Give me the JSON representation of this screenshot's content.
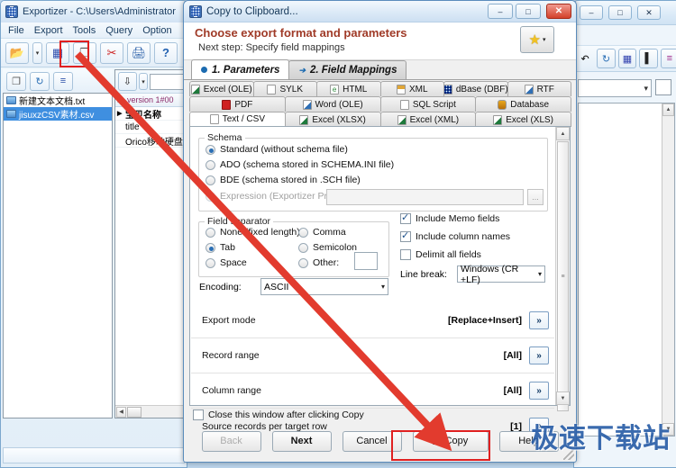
{
  "main_window": {
    "title": "Exportizer - C:\\Users\\Administrator",
    "icon": "grid-app-icon",
    "menu": [
      {
        "label": "File"
      },
      {
        "label": "Export"
      },
      {
        "label": "Tools"
      },
      {
        "label": "Query"
      },
      {
        "label": "Option"
      }
    ],
    "toolbar": [
      {
        "name": "open-button",
        "glyph": "📂"
      },
      {
        "name": "open-dropdown",
        "glyph": "▾"
      },
      {
        "name": "export-grid-button",
        "glyph": "▦"
      },
      {
        "name": "copy-to-clipboard-button",
        "glyph": "❐"
      },
      {
        "name": "script-button",
        "glyph": "✂"
      },
      {
        "name": "print-button",
        "glyph": "🖨"
      },
      {
        "name": "help-button",
        "glyph": "?"
      }
    ],
    "sub_toolbar": [
      {
        "name": "duplicate-button",
        "glyph": "❐"
      },
      {
        "name": "refresh-button",
        "glyph": "↻"
      },
      {
        "name": "list-button",
        "glyph": "≡"
      }
    ],
    "file_list": [
      {
        "label": "新建文本文档.txt",
        "selected": false
      },
      {
        "label": "jisuxzCSV素材.csv",
        "selected": true
      }
    ],
    "grid": {
      "header": "version 1#00",
      "rows": [
        {
          "mark": "▶",
          "value": "宝贝名称"
        },
        {
          "mark": "",
          "value": "title"
        },
        {
          "mark": "",
          "value": "Orico移动硬盘"
        }
      ]
    }
  },
  "background_window": {
    "title_buttons": [
      {
        "name": "minimize-button",
        "glyph": "–"
      },
      {
        "name": "maximize-button",
        "glyph": "□"
      },
      {
        "name": "close-button",
        "glyph": "✕"
      }
    ],
    "toolbar": [
      {
        "name": "undo-icon",
        "glyph": "↶"
      },
      {
        "name": "refresh-icon",
        "glyph": "↻"
      },
      {
        "name": "grid-icon",
        "glyph": "▦"
      },
      {
        "name": "align-left-icon",
        "glyph": "▌"
      },
      {
        "name": "format-icon",
        "glyph": "≡"
      }
    ],
    "combo_value": "",
    "combo_caret": "▾"
  },
  "dialog": {
    "title": "Copy to Clipboard...",
    "icon": "grid-app-icon",
    "title_buttons": [
      {
        "name": "minimize-button",
        "glyph": "–"
      },
      {
        "name": "maximize-button",
        "glyph": "□"
      },
      {
        "name": "close-button",
        "glyph": "✕"
      }
    ],
    "heading": "Choose export format and parameters",
    "subheading": "Next step: Specify field mappings",
    "favorites_button": {
      "icon": "star-icon",
      "caret": "▾"
    },
    "step_tabs": [
      {
        "label": "1. Parameters",
        "icon": "bullet-icon",
        "active": true
      },
      {
        "label": "2. Field Mappings",
        "icon": "arrow-bullet-icon",
        "active": false
      }
    ],
    "format_tabs": [
      [
        {
          "label": "Excel (OLE)",
          "icon": "excel-icon",
          "active": false
        },
        {
          "label": "SYLK",
          "icon": "file-icon",
          "active": false
        },
        {
          "label": "HTML",
          "icon": "html-icon",
          "active": false
        },
        {
          "label": "XML",
          "icon": "xml-icon",
          "active": false
        },
        {
          "label": "dBase (DBF)",
          "icon": "dbf-icon",
          "active": false
        },
        {
          "label": "RTF",
          "icon": "rtf-icon",
          "active": false
        }
      ],
      [
        {
          "label": "PDF",
          "icon": "pdf-icon",
          "active": false
        },
        {
          "label": "Word (OLE)",
          "icon": "word-icon",
          "active": false
        },
        {
          "label": "SQL Script",
          "icon": "file-icon",
          "active": false
        },
        {
          "label": "Database",
          "icon": "database-icon",
          "active": false
        }
      ],
      [
        {
          "label": "Text / CSV",
          "icon": "file-icon",
          "active": true
        },
        {
          "label": "Excel (XLSX)",
          "icon": "excel-icon",
          "active": false
        },
        {
          "label": "Excel (XML)",
          "icon": "excel-icon",
          "active": false
        },
        {
          "label": "Excel (XLS)",
          "icon": "excel-icon",
          "active": false
        }
      ]
    ],
    "schema": {
      "title": "Schema",
      "options": [
        {
          "label": "Standard (without schema file)",
          "selected": true,
          "disabled": false
        },
        {
          "label": "ADO (schema stored in SCHEMA.INI file)",
          "selected": false,
          "disabled": false
        },
        {
          "label": "BDE (schema stored in .SCH file)",
          "selected": false,
          "disabled": false
        },
        {
          "label": "Expression (Exportizer Pro)",
          "selected": false,
          "disabled": true
        }
      ],
      "expression_value": "",
      "browse_label": "..."
    },
    "field_separator": {
      "title": "Field separator",
      "options_left": [
        {
          "label": "None (fixed length)",
          "selected": false
        },
        {
          "label": "Tab",
          "selected": true
        },
        {
          "label": "Space",
          "selected": false
        }
      ],
      "options_right": [
        {
          "label": "Comma",
          "selected": false
        },
        {
          "label": "Semicolon",
          "selected": false
        },
        {
          "label": "Other:",
          "selected": false
        }
      ],
      "other_value": ""
    },
    "encoding": {
      "label": "Encoding:",
      "value": "ASCII",
      "caret": "▾"
    },
    "checkboxes": [
      {
        "label": "Include Memo fields",
        "checked": true
      },
      {
        "label": "Include column names",
        "checked": true
      },
      {
        "label": "Delimit all fields",
        "checked": false
      }
    ],
    "line_break": {
      "label": "Line break:",
      "value": "Windows (CR +LF)",
      "caret": "▾"
    },
    "option_rows": [
      {
        "label": "Export mode",
        "value": "[Replace+Insert]",
        "button": "»"
      },
      {
        "label": "Record range",
        "value": "[All]",
        "button": "»"
      },
      {
        "label": "Column range",
        "value": "[All]",
        "button": "»"
      },
      {
        "label": "Source records per target row",
        "value": "[1]",
        "button": "»"
      }
    ],
    "close_after": {
      "label": "Close this window after clicking Copy",
      "checked": false
    },
    "buttons": [
      {
        "label": "Back",
        "name": "back-button",
        "disabled": true,
        "icon": null
      },
      {
        "label": "Next",
        "name": "next-button",
        "disabled": false,
        "icon": null
      },
      {
        "label": "Cancel",
        "name": "cancel-button",
        "disabled": false,
        "icon": null
      },
      {
        "label": "Copy",
        "name": "copy-button",
        "disabled": false,
        "icon": "copy-icon"
      },
      {
        "label": "Help",
        "name": "help-button",
        "disabled": false,
        "icon": null
      }
    ]
  },
  "annotations": {
    "highlight_color": "#e02020",
    "arrow_color": "#e23b2e",
    "watermark": "极速下载站"
  }
}
